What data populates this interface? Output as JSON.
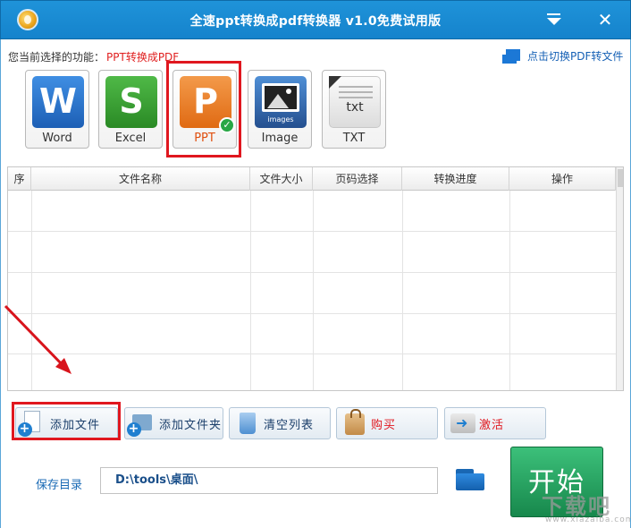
{
  "window": {
    "title": "全速ppt转换成pdf转换器 v1.0免费试用版"
  },
  "function_bar": {
    "label": "您当前选择的功能：",
    "value": "PPT转换成PDF",
    "switch_link": "点击切换PDF转文件"
  },
  "formats": [
    {
      "label": "Word",
      "glyph": "W"
    },
    {
      "label": "Excel",
      "glyph": "S"
    },
    {
      "label": "PPT",
      "glyph": "P",
      "selected": true
    },
    {
      "label": "Image",
      "glyph": "images"
    },
    {
      "label": "TXT",
      "glyph": "txt"
    }
  ],
  "table": {
    "columns": [
      "序",
      "文件名称",
      "文件大小",
      "页码选择",
      "转换进度",
      "操作"
    ],
    "rows": []
  },
  "buttons": {
    "add_file": "添加文件",
    "add_folder": "添加文件夹",
    "clear_list": "清空列表",
    "buy": "购买",
    "activate": "激活",
    "start": "开始"
  },
  "save": {
    "label": "保存目录",
    "path": "D:\\tools\\桌面\\"
  },
  "watermark": {
    "big": "下载吧",
    "small": "www.xiazaiba.com"
  },
  "colors": {
    "title_bar": "#1a8ad4",
    "highlight_red": "#e0171f",
    "start_green": "#1f9a59"
  }
}
